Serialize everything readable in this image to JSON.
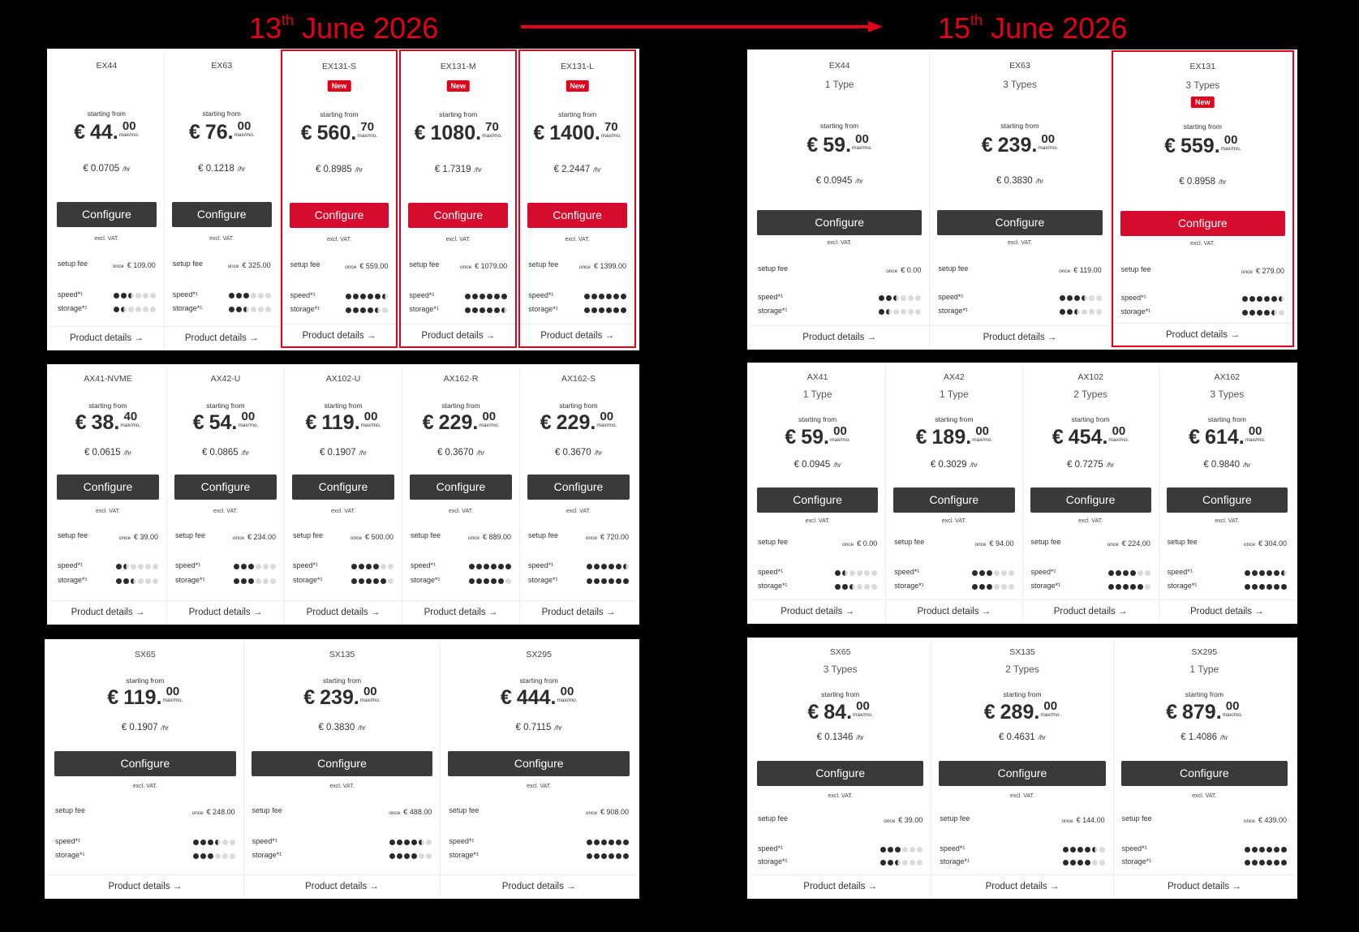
{
  "header": {
    "left_date": {
      "day": "13",
      "suffix": "th",
      "rest": " June 2026"
    },
    "right_date": {
      "day": "15",
      "suffix": "th",
      "rest": " June 2026"
    }
  },
  "labels": {
    "starting_from": "starting from",
    "per_month": "max/mo.",
    "per_hour": "/hr",
    "configure": "Configure",
    "excl_vat": "excl. VAT.",
    "setup_fee": "setup fee",
    "once": "once",
    "speed": "speed*¹",
    "storage": "storage*¹",
    "product_details": "Product details →",
    "new_badge": "New"
  },
  "colors": {
    "accent": "#e3001b",
    "button_dark": "#3a3a3a",
    "button_red": "#d50c2d"
  },
  "panels": [
    {
      "id": "ex-old",
      "cards": [
        {
          "name": "EX44",
          "euros": "44",
          "cents": "00",
          "hourly": "€ 0.0705",
          "setup": "€ 109.00",
          "speed": 2.5,
          "storage": 1.5
        },
        {
          "name": "EX63",
          "euros": "76",
          "cents": "00",
          "hourly": "€ 0.1218",
          "setup": "€ 325.00",
          "speed": 3,
          "storage": 2.5
        },
        {
          "name": "EX131-S",
          "new": true,
          "euros": "560",
          "cents": "70",
          "hourly": "€ 0.8985",
          "setup": "€ 559.00",
          "speed": 5.5,
          "storage": 4.5
        },
        {
          "name": "EX131-M",
          "new": true,
          "euros": "1080",
          "cents": "70",
          "hourly": "€ 1.7319",
          "setup": "€ 1079.00",
          "speed": 6,
          "storage": 5.5
        },
        {
          "name": "EX131-L",
          "new": true,
          "euros": "1400",
          "cents": "70",
          "hourly": "€ 2.2447",
          "setup": "€ 1399.00",
          "speed": 6,
          "storage": 6
        }
      ]
    },
    {
      "id": "ex-new",
      "cards": [
        {
          "name": "EX44",
          "types": "1 Type",
          "euros": "59",
          "cents": "00",
          "hourly": "€ 0.0945",
          "setup": "€ 0.00",
          "speed": 2.5,
          "storage": 1.5
        },
        {
          "name": "EX63",
          "types": "3 Types",
          "euros": "239",
          "cents": "00",
          "hourly": "€ 0.3830",
          "setup": "€ 119.00",
          "speed": 3.5,
          "storage": 2.5
        },
        {
          "name": "EX131",
          "types": "3 Types",
          "new": true,
          "euros": "559",
          "cents": "00",
          "hourly": "€ 0.8958",
          "setup": "€ 279.00",
          "speed": 5.5,
          "storage": 4.5
        }
      ]
    },
    {
      "id": "ax-old",
      "cards": [
        {
          "name": "AX41-NVME",
          "euros": "38",
          "cents": "40",
          "hourly": "€ 0.0615",
          "setup": "€ 39.00",
          "speed": 1.5,
          "storage": 2.5
        },
        {
          "name": "AX42-U",
          "euros": "54",
          "cents": "00",
          "hourly": "€ 0.0865",
          "setup": "€ 234.00",
          "speed": 3,
          "storage": 3
        },
        {
          "name": "AX102-U",
          "euros": "119",
          "cents": "00",
          "hourly": "€ 0.1907",
          "setup": "€ 500.00",
          "speed": 4,
          "storage": 5
        },
        {
          "name": "AX162-R",
          "euros": "229",
          "cents": "00",
          "hourly": "€ 0.3670",
          "setup": "€ 889.00",
          "speed": 6,
          "storage": 5
        },
        {
          "name": "AX162-S",
          "euros": "229",
          "cents": "00",
          "hourly": "€ 0.3670",
          "setup": "€ 720.00",
          "speed": 5.5,
          "storage": 6
        }
      ]
    },
    {
      "id": "ax-new",
      "cards": [
        {
          "name": "AX41",
          "types": "1 Type",
          "euros": "59",
          "cents": "00",
          "hourly": "€ 0.0945",
          "setup": "€ 0.00",
          "speed": 1.5,
          "storage": 2.5
        },
        {
          "name": "AX42",
          "types": "1 Type",
          "euros": "189",
          "cents": "00",
          "hourly": "€ 0.3029",
          "setup": "€ 94.00",
          "speed": 3,
          "storage": 3
        },
        {
          "name": "AX102",
          "types": "2 Types",
          "euros": "454",
          "cents": "00",
          "hourly": "€ 0.7275",
          "setup": "€ 224.00",
          "speed": 4,
          "storage": 5
        },
        {
          "name": "AX162",
          "types": "3 Types",
          "euros": "614",
          "cents": "00",
          "hourly": "€ 0.9840",
          "setup": "€ 304.00",
          "speed": 5.5,
          "storage": 6
        }
      ]
    },
    {
      "id": "sx-old",
      "cards": [
        {
          "name": "SX65",
          "euros": "119",
          "cents": "00",
          "hourly": "€ 0.1907",
          "setup": "€ 248.00",
          "speed": 3.5,
          "storage": 3
        },
        {
          "name": "SX135",
          "euros": "239",
          "cents": "00",
          "hourly": "€ 0.3830",
          "setup": "€ 488.00",
          "speed": 4.5,
          "storage": 4
        },
        {
          "name": "SX295",
          "euros": "444",
          "cents": "00",
          "hourly": "€ 0.7115",
          "setup": "€ 908.00",
          "speed": 6,
          "storage": 6
        }
      ]
    },
    {
      "id": "sx-new",
      "cards": [
        {
          "name": "SX65",
          "types": "3 Types",
          "euros": "84",
          "cents": "00",
          "hourly": "€ 0.1346",
          "setup": "€ 39.00",
          "speed": 3,
          "storage": 2.5
        },
        {
          "name": "SX135",
          "types": "2 Types",
          "euros": "289",
          "cents": "00",
          "hourly": "€ 0.4631",
          "setup": "€ 144.00",
          "speed": 4.5,
          "storage": 4
        },
        {
          "name": "SX295",
          "types": "1 Type",
          "euros": "879",
          "cents": "00",
          "hourly": "€ 1.4086",
          "setup": "€ 439.00",
          "speed": 6,
          "storage": 6
        }
      ]
    }
  ]
}
